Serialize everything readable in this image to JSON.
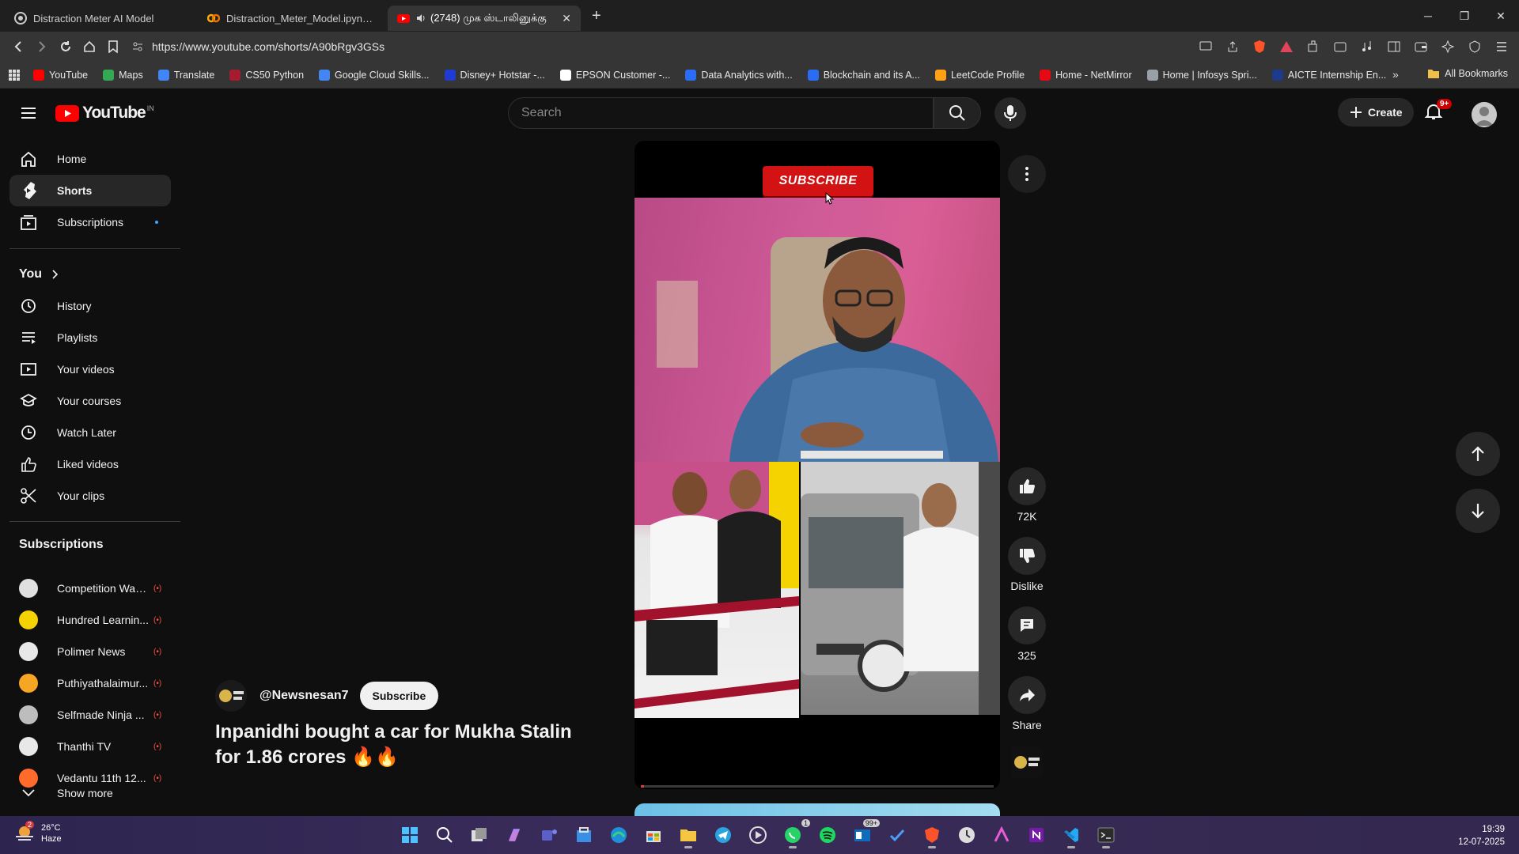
{
  "browser": {
    "tabs": [
      {
        "title": "Distraction Meter AI Model",
        "active": false
      },
      {
        "title": "Distraction_Meter_Model.ipynb - Col",
        "active": false
      },
      {
        "title": "(2748) முக ஸ்டாலினுக்கு",
        "active": true
      }
    ],
    "url": "https://www.youtube.com/shorts/A90bRgv3GSs",
    "bookmarks": [
      {
        "label": "YouTube",
        "color": "#ff0000"
      },
      {
        "label": "Maps",
        "color": "#34a853"
      },
      {
        "label": "Translate",
        "color": "#4285f4"
      },
      {
        "label": "CS50 Python",
        "color": "#a51c30"
      },
      {
        "label": "Google Cloud Skills...",
        "color": "#4285f4"
      },
      {
        "label": "Disney+ Hotstar -...",
        "color": "#1f3bd0"
      },
      {
        "label": "EPSON Customer -...",
        "color": "#ffffff"
      },
      {
        "label": "Data Analytics with...",
        "color": "#2a6df4"
      },
      {
        "label": "Blockchain and its A...",
        "color": "#2a6df4"
      },
      {
        "label": "LeetCode Profile",
        "color": "#ffa116"
      },
      {
        "label": "Home - NetMirror",
        "color": "#e50914"
      },
      {
        "label": "Home | Infosys Spri...",
        "color": "#9aa0a6"
      },
      {
        "label": "AICTE Internship En...",
        "color": "#1e3a8a"
      }
    ],
    "all_bookmarks": "All Bookmarks"
  },
  "header": {
    "logo_text": "YouTube",
    "region": "IN",
    "search_placeholder": "Search",
    "create_label": "Create",
    "notif_count": "9+"
  },
  "sidebar": {
    "main": [
      {
        "label": "Home",
        "icon": "home-icon"
      },
      {
        "label": "Shorts",
        "icon": "shorts-icon",
        "active": true
      },
      {
        "label": "Subscriptions",
        "icon": "subscriptions-icon"
      }
    ],
    "you_heading": "You",
    "you_items": [
      {
        "label": "History",
        "icon": "history-icon"
      },
      {
        "label": "Playlists",
        "icon": "playlists-icon"
      },
      {
        "label": "Your videos",
        "icon": "your-videos-icon"
      },
      {
        "label": "Your courses",
        "icon": "courses-icon"
      },
      {
        "label": "Watch Later",
        "icon": "watch-later-icon"
      },
      {
        "label": "Liked videos",
        "icon": "liked-icon"
      },
      {
        "label": "Your clips",
        "icon": "clips-icon"
      }
    ],
    "subs_heading": "Subscriptions",
    "subscriptions": [
      {
        "name": "Competition Wall...",
        "color": "#e0e0e0"
      },
      {
        "name": "Hundred Learnin...",
        "color": "#f5d300"
      },
      {
        "name": "Polimer News",
        "color": "#e8e8e8"
      },
      {
        "name": "Puthiyathalaimur...",
        "color": "#f5a623"
      },
      {
        "name": "Selfmade Ninja ...",
        "color": "#bdbdbd"
      },
      {
        "name": "Thanthi TV",
        "color": "#e8e8e8"
      },
      {
        "name": "Vedantu 11th 12...",
        "color": "#ff6b2b"
      }
    ],
    "show_more": "Show more"
  },
  "short": {
    "subscribe_banner": "SUBSCRIBE",
    "progress": 0.01,
    "channel": "@Newsnesan7",
    "subscribe_button": "Subscribe",
    "title": "Inpanidhi bought a car for Mukha Stalin for 1.86 crores 🔥🔥",
    "likes": "72K",
    "dislike_label": "Dislike",
    "comments": "325",
    "share_label": "Share"
  },
  "taskbar": {
    "temp": "26°C",
    "weather": "Haze",
    "weather_badge": "2",
    "time": "19:39",
    "date": "12-07-2025",
    "whatsapp_badge": "1",
    "mail_badge": "99+"
  },
  "colors": {
    "accent_red": "#ff0000",
    "subscribe_red": "#d31313",
    "link_blue": "#3ea6ff"
  }
}
